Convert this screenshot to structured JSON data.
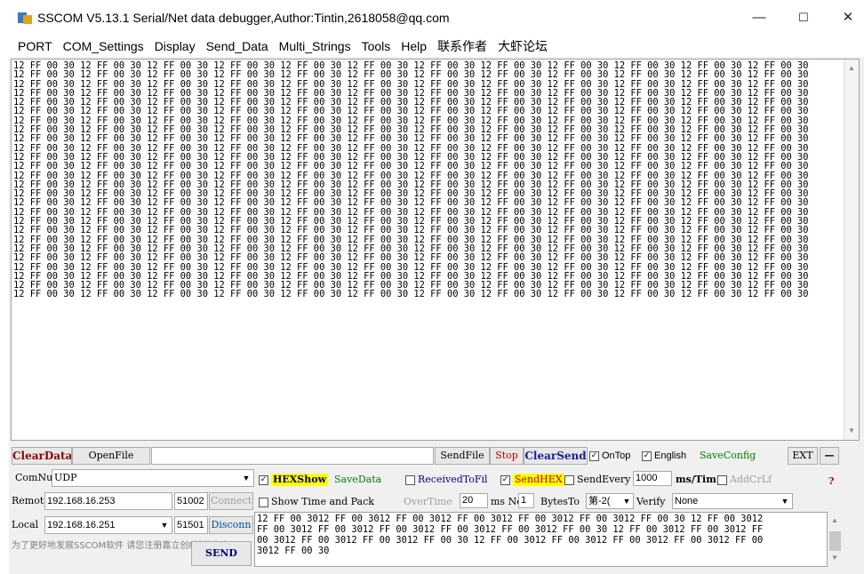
{
  "window": {
    "title": "SSCOM V5.13.1 Serial/Net data debugger,Author:Tintin,2618058@qq.com",
    "minimize": "—",
    "maximize": "☐",
    "close": "✕"
  },
  "menu": [
    "PORT",
    "COM_Settings",
    "Display",
    "Send_Data",
    "Multi_Strings",
    "Tools",
    "Help",
    "联系作者",
    "大虾论坛"
  ],
  "receive": {
    "line": "12 FF 00 30 12 FF 00 30 12 FF 00 30 12 FF 00 30 12 FF 00 30 12 FF 00 30 12 FF 00 30 12 FF 00 30 12 FF 00 30 12 FF 00 30 12 FF 00 30 12 FF 00 30",
    "line_count": 26
  },
  "toolbar": {
    "clear_data": "ClearData",
    "open_file": "OpenFile",
    "send_file": "SendFile",
    "stop": "Stop",
    "clear_send": "ClearSend",
    "on_top": "OnTop",
    "english": "English",
    "save_config": "SaveConfig",
    "ext": "EXT",
    "dash": "—"
  },
  "connection": {
    "comnum_label": "ComNum",
    "comnum_value": "UDP",
    "remote_label": "Remot",
    "remote_ip": "192.168.16.253",
    "remote_port": "51002",
    "connect": "Connect",
    "local_label": "Local",
    "local_ip": "192.168.16.251",
    "local_port": "51501",
    "disconnect": "Disconn"
  },
  "options": {
    "hex_show": "HEXShow",
    "save_data": "SaveData",
    "received_to_file": "ReceivedToFil",
    "send_hex": "SendHEX",
    "send_every": "SendEvery",
    "send_every_value": "1000",
    "ms_tim": "ms/Tim",
    "add_crlf": "AddCrLf",
    "help": "?",
    "show_time": "Show Time and Pack",
    "overtime": "OverTime",
    "overtime_value": "20",
    "ms_no": "ms No",
    "no_value": "1",
    "bytes_to": "BytesTo",
    "bytes_to_value": "第-2(",
    "verify": "Verify",
    "verify_value": "None"
  },
  "send": {
    "text": "12 FF 00 3012 FF 00 3012 FF 00 3012 FF 00 3012 FF 00 3012 FF 00 3012 FF 00 30 12 FF 00 3012\nFF 00 3012 FF 00 3012 FF 00 3012 FF 00 3012 FF 00 3012 FF 00 30 12 FF 00 3012 FF 00 3012 FF\n00 3012 FF 00 3012 FF 00 3012 FF 00 30 12 FF 00 3012 FF 00 3012 FF 00 3012 FF 00 3012 FF 00\n3012 FF 00 30",
    "button": "SEND",
    "promo": "为了更好地发展SSCOM软件\n请您注册嘉立创F结尾客户"
  },
  "colors": {
    "highlight": "#ffff00",
    "clear_data": "#8b0000",
    "stop": "#c00000",
    "clear_send": "#1a1a9a",
    "green_link": "#008000",
    "navy": "#000080",
    "gray_text": "#a0a0a0"
  }
}
